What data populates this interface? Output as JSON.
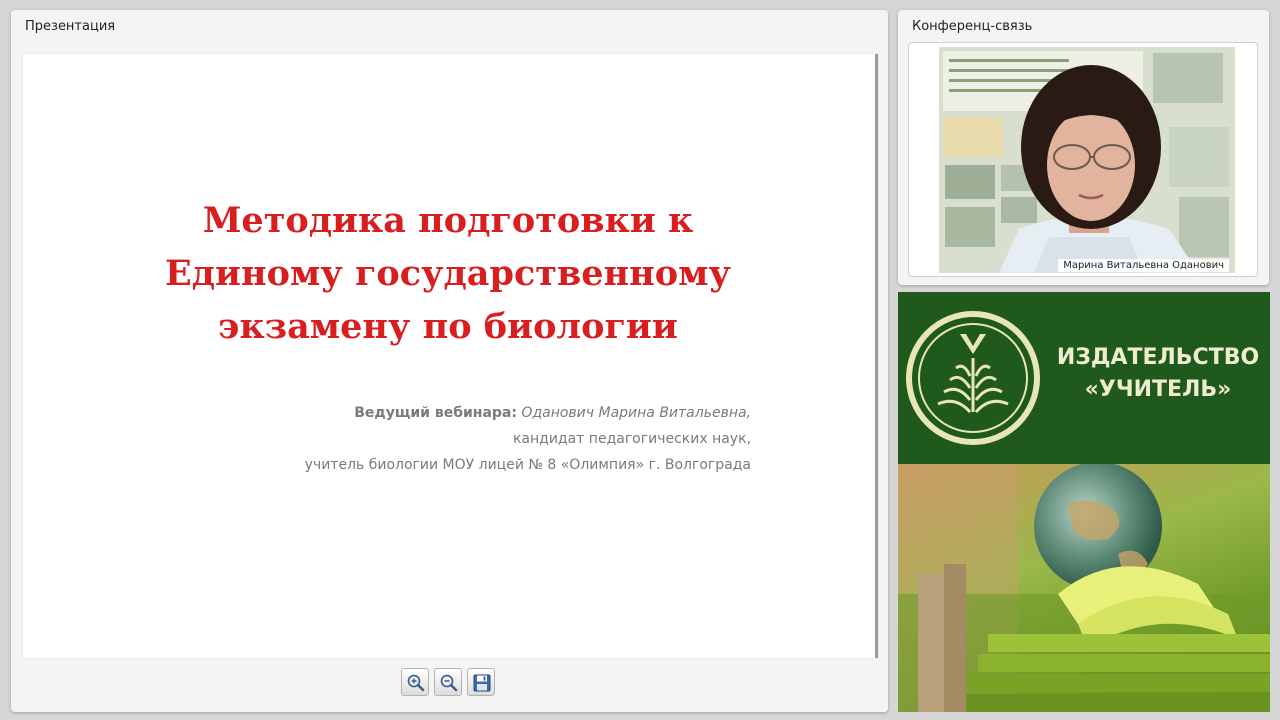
{
  "presentation": {
    "panel_title": "Презентация",
    "slide": {
      "title": "Методика подготовки к\nЕдиному государственному\nэкзамену по биологии",
      "lead_label": "Ведущий вебинара:",
      "lead_name": "Оданович Марина Витальевна,",
      "degree": "кандидат педагогических наук,",
      "position": "учитель биологии МОУ лицей № 8 «Олимпия» г. Волгограда"
    },
    "toolbar": [
      {
        "name": "zoom-in",
        "icon": "zoom-in-icon"
      },
      {
        "name": "zoom-out",
        "icon": "zoom-out-icon"
      },
      {
        "name": "save",
        "icon": "save-icon"
      }
    ]
  },
  "conference": {
    "panel_title": "Конференц-связь",
    "speaker_name": "Марина Витальевна Оданович"
  },
  "banner": {
    "publisher_name": "ИЗДАТЕЛЬСТВО\n«УЧИТЕЛЬ»"
  },
  "colors": {
    "slide_title": "#d81e1e",
    "banner_green": "#1f5a1c",
    "logo_cream": "#e8e6b8"
  }
}
